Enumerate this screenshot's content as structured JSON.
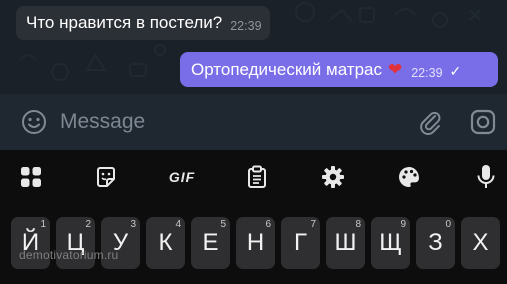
{
  "chat": {
    "incoming": {
      "text": "Что нравится в постели?",
      "time": "22:39"
    },
    "outgoing": {
      "text": "Ортопедический матрас",
      "emoji": "❤",
      "time": "22:39",
      "status_icon": "single-check-icon"
    }
  },
  "composer": {
    "placeholder": "Message",
    "value": "",
    "icons": [
      "emoji-icon",
      "paperclip-icon",
      "instagram-camera-icon"
    ]
  },
  "keyboard_toolbar": {
    "items": [
      "apps-grid-icon",
      "sticker-icon",
      "GIF",
      "clipboard-icon",
      "settings-gear-icon",
      "palette-icon",
      "microphone-icon"
    ],
    "gif_label": "GIF"
  },
  "keyboard": {
    "row": [
      {
        "letter": "Й",
        "num": "1"
      },
      {
        "letter": "Ц",
        "num": "2"
      },
      {
        "letter": "У",
        "num": "3"
      },
      {
        "letter": "К",
        "num": "4"
      },
      {
        "letter": "Е",
        "num": "5"
      },
      {
        "letter": "Н",
        "num": "6"
      },
      {
        "letter": "Г",
        "num": "7"
      },
      {
        "letter": "Ш",
        "num": "8"
      },
      {
        "letter": "Щ",
        "num": "9"
      },
      {
        "letter": "З",
        "num": "0"
      },
      {
        "letter": "Х",
        "num": ""
      }
    ]
  },
  "watermark": "demotivatorium.ru",
  "colors": {
    "chat_bg": "#1a2129",
    "incoming_bubble": "#2b3036",
    "outgoing_bubble": "#7a6ee8",
    "composer_bg": "#1f2730",
    "keyboard_bg": "#0d0d0e",
    "key_bg": "#2f2f31"
  }
}
